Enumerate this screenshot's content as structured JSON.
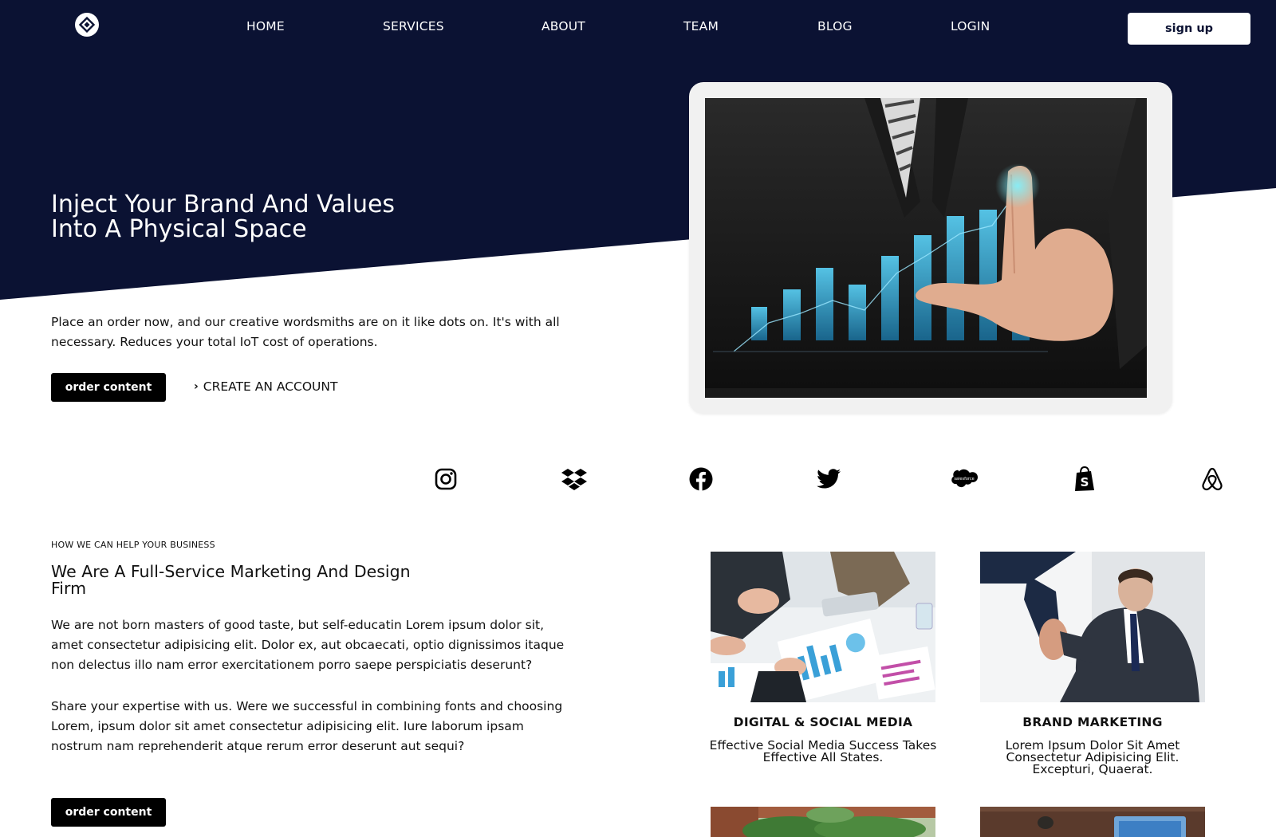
{
  "nav": {
    "logo": "logo-icon",
    "links": [
      "HOME",
      "SERVICES",
      "ABOUT",
      "TEAM",
      "BLOG",
      "LOGIN"
    ],
    "signup_label": "sign up"
  },
  "hero": {
    "title_line1": "Inject Your Brand And Values",
    "title_line2": "Into A Physical Space",
    "description": "Place an order now, and our creative wordsmiths are on it like dots on. It's with all necessary. Reduces your total IoT cost of operations.",
    "order_button": "order content",
    "create_account": "CREATE AN ACCOUNT",
    "image": "businessman-touching-growth-chart-photo"
  },
  "brands": [
    "instagram-icon",
    "dropbox-icon",
    "facebook-icon",
    "twitter-icon",
    "salesforce-icon",
    "shopify-icon",
    "airbnb-icon"
  ],
  "services": {
    "kicker": "HOW WE CAN HELP YOUR BUSINESS",
    "title_line1": "We Are A Full-Service Marketing And Design",
    "title_line2": "Firm",
    "paragraph1": "We are not born masters of good taste, but self-educatin Lorem ipsum dolor sit, amet consectetur adipisicing elit. Dolor ex, aut obcaecati, optio dignissimos itaque non delectus illo nam error exercitationem porro saepe perspiciatis deserunt?",
    "paragraph2": "Share your expertise with us. Were we successful in combining fonts and choosing Lorem, ipsum dolor sit amet consectetur adipisicing elit. Iure laborum ipsam nostrum nam reprehenderit atque rerum error deserunt aut sequi?",
    "order_button": "order content",
    "cards": [
      {
        "title": "DIGITAL & SOCIAL MEDIA",
        "text_line1": "Effective Social Media Success Takes",
        "text_line2": "Effective All States.",
        "image": "business-meeting-photo"
      },
      {
        "title": "BRAND MARKETING",
        "text_line1": "Lorem Ipsum Dolor Sit Amet",
        "text_line2": "Consectetur Adipisicing Elit.",
        "text_line3": "Excepturi, Quaerat.",
        "image": "handshake-photo"
      }
    ]
  },
  "colors": {
    "navy": "#0b1233",
    "white": "#ffffff",
    "black": "#000000",
    "chart_blue": "#2aa7d8"
  }
}
